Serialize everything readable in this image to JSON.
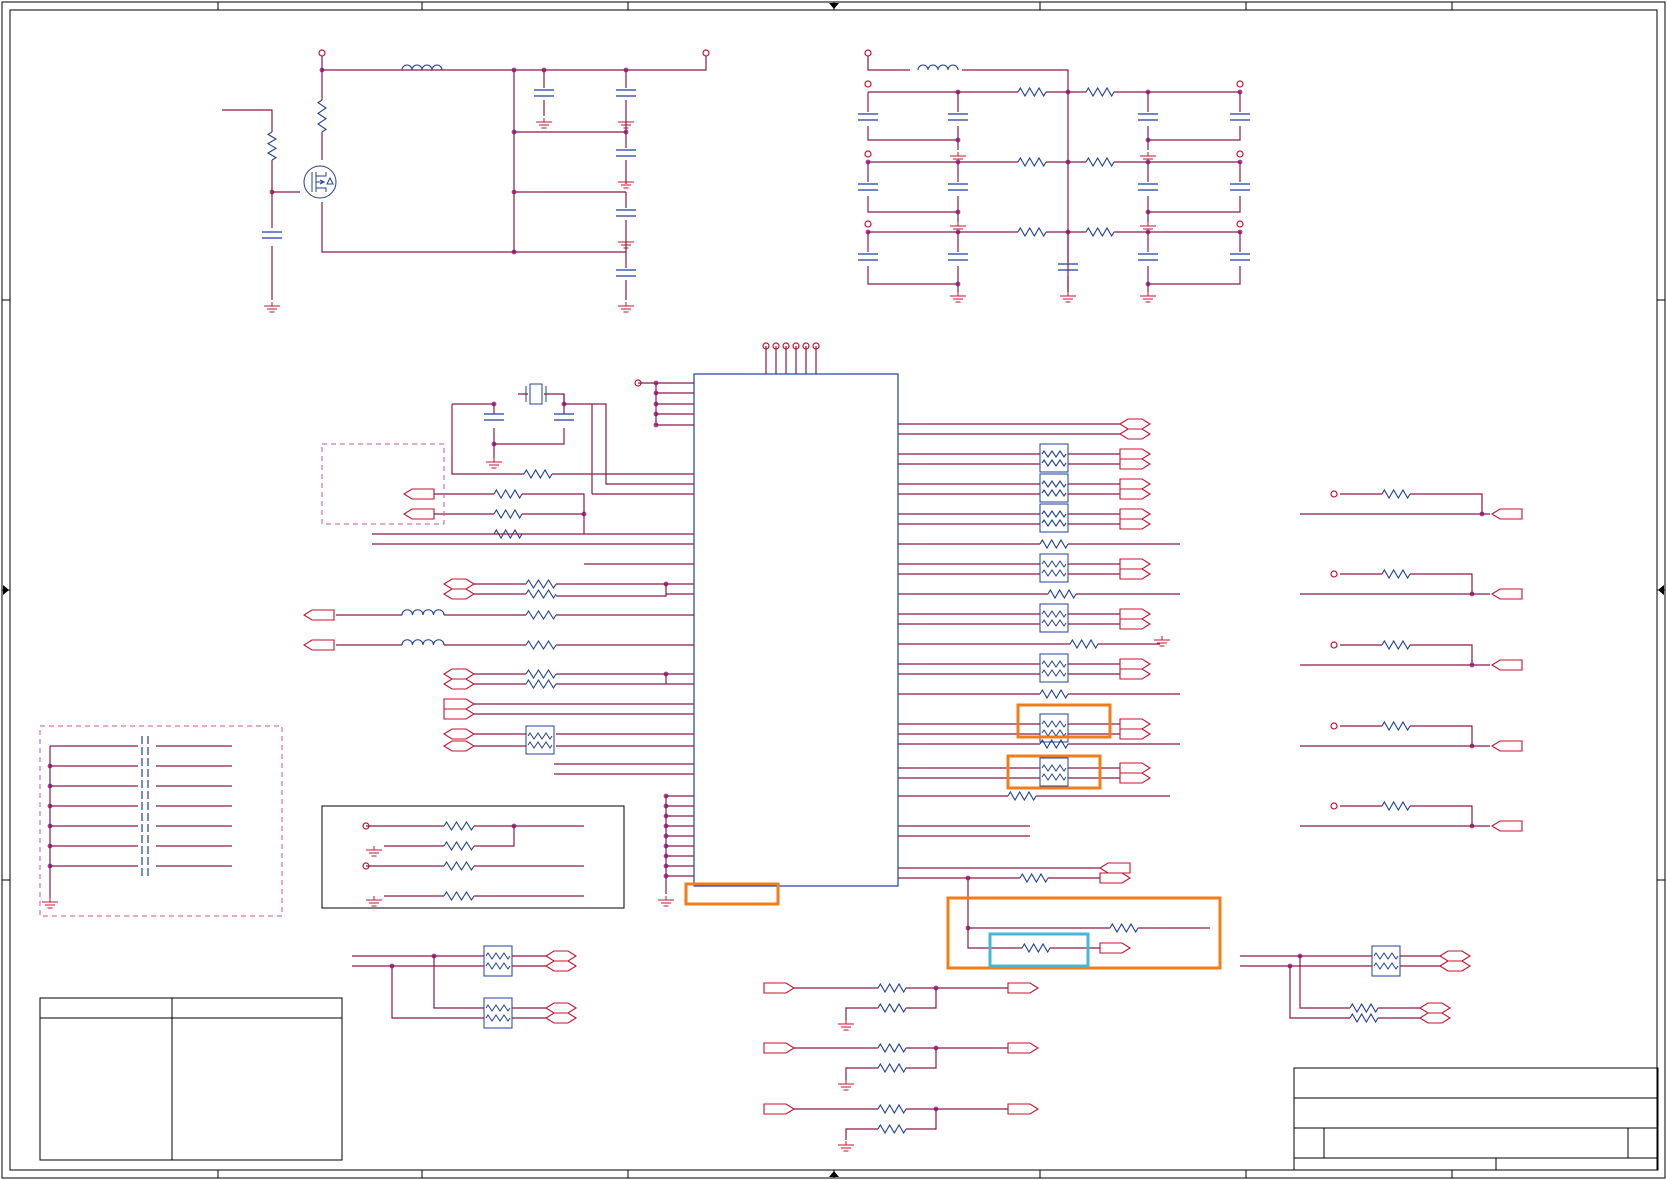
{
  "schematic": {
    "colors": {
      "wire": "#8b1a4a",
      "net": "#c8102e",
      "component": "#1f3fa0",
      "junction": "#b13aa0",
      "frame": "#000000",
      "highlight_orange": "#f07d1a",
      "highlight_cyan": "#45b8d8",
      "group_dashed": "#d2519c"
    },
    "title_block": {
      "rows": 4,
      "text": []
    },
    "revision_table": {
      "columns": 2,
      "text": []
    },
    "highlights": [
      {
        "kind": "orange",
        "label": ""
      },
      {
        "kind": "orange",
        "label": ""
      },
      {
        "kind": "orange",
        "label": ""
      },
      {
        "kind": "orange",
        "label": ""
      },
      {
        "kind": "cyan",
        "label": ""
      }
    ]
  }
}
